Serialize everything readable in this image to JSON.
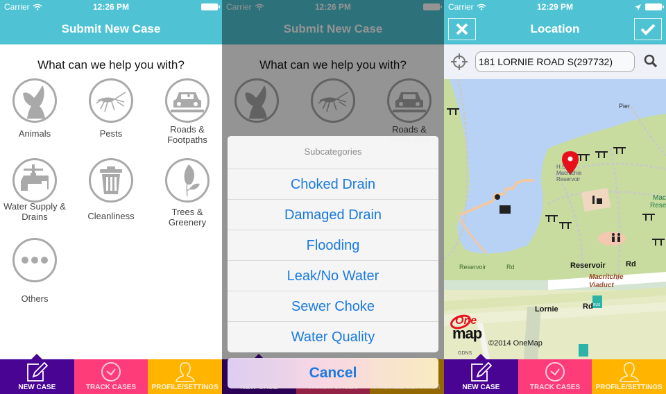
{
  "status_bars": [
    {
      "carrier": "Carrier",
      "time": "12:26 PM"
    },
    {
      "carrier": "Carrier",
      "time": "12:26 PM"
    },
    {
      "carrier": "Carrier",
      "time": "12:29 PM"
    }
  ],
  "submit_screen": {
    "title": "Submit New Case",
    "question": "What can we help you with?",
    "categories": [
      {
        "label": "Animals",
        "icon": "dog-icon"
      },
      {
        "label": "Pests",
        "icon": "mosquito-icon"
      },
      {
        "label": "Roads & Footpaths",
        "icon": "car-icon"
      },
      {
        "label": "Water Supply & Drains",
        "icon": "faucet-icon"
      },
      {
        "label": "Cleanliness",
        "icon": "trash-icon"
      },
      {
        "label": "Trees & Greenery",
        "icon": "leaf-icon"
      },
      {
        "label": "Others",
        "icon": "more-icon"
      }
    ]
  },
  "subcategory_sheet": {
    "title": "Subcategories",
    "items": [
      "Choked Drain",
      "Damaged Drain",
      "Flooding",
      "Leak/No Water",
      "Sewer Choke",
      "Water Quality"
    ],
    "cancel": "Cancel"
  },
  "location_screen": {
    "title": "Location",
    "close_icon": "close-icon",
    "confirm_icon": "checkmark-icon",
    "search_value": "181 LORNIE ROAD S(297732)",
    "map": {
      "labels": {
        "pier": "Pier",
        "hs": "H.S.",
        "reservoir_name_1": "Macritchie",
        "reservoir_name_2": "Reservoir",
        "mac": "Mac",
        "rese": "Rese",
        "reservoir_rd_left": "Reservoir",
        "rd_left": "Rd",
        "reservoir_rd_right": "Reservoir",
        "rd_right": "Rd",
        "viaduct_1": "Macritchie",
        "viaduct_2": "Viaduct",
        "lornie": "Lornie",
        "lornie_rd": "Rd",
        "bus": "BUS",
        "gdns": "GDNS"
      },
      "logo_top": "One",
      "logo_bottom": "map",
      "copyright": "©2014 OneMap"
    }
  },
  "tabbar": {
    "tabs": [
      {
        "label": "NEW CASE",
        "icon": "edit-icon"
      },
      {
        "label": "TRACK CASES",
        "icon": "clock-icon"
      },
      {
        "label": "PROFILE/SETTINGS",
        "icon": "person-icon"
      }
    ]
  },
  "colors": {
    "nav": "#4fc3d4",
    "tab_new": "#4a0494",
    "tab_track": "#ff3c7a",
    "tab_profile": "#ffb400",
    "sheet_text": "#1a7ae0",
    "pin": "#e8101a"
  }
}
